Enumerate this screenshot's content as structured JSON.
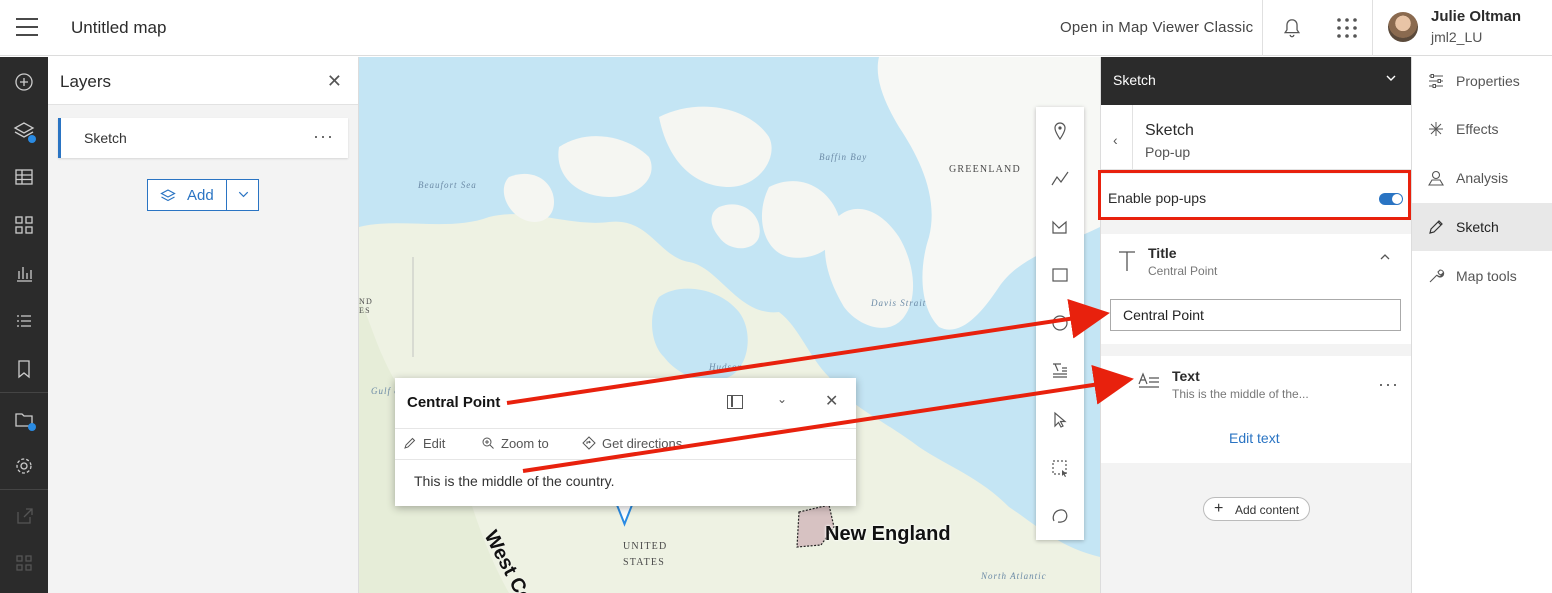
{
  "header": {
    "map_title": "Untitled map",
    "open_classic_label": "Open in Map Viewer Classic",
    "user_name": "Julie Oltman",
    "user_id": "jml2_LU"
  },
  "layers_panel": {
    "title": "Layers",
    "layer_items": [
      {
        "label": "Sketch"
      }
    ],
    "add_label": "Add"
  },
  "map": {
    "labels": {
      "beaufort_sea": "Beaufort Sea",
      "baffin_bay": "Baffin Bay",
      "greenland": "GREENLAND",
      "davis_strait": "Davis Strait",
      "gulf_alaska": "Gulf of Alaska",
      "hudson": "Hudson",
      "united_states": "UNITED STATES",
      "north_atlantic": "North Atlantic",
      "new_england": "New England",
      "west_coast": "West Coa",
      "partial_left": "ND ES"
    }
  },
  "popup": {
    "title": "Central Point",
    "actions": {
      "edit": "Edit",
      "zoom_to": "Zoom to",
      "directions": "Get directions"
    },
    "body": "This is the middle of the country."
  },
  "sketch_panel": {
    "dropdown_label": "Sketch",
    "sub_title": "Sketch",
    "sub_subtitle": "Pop-up",
    "enable_label": "Enable pop-ups",
    "enable_value": true,
    "title_label": "Title",
    "title_sub": "Central Point",
    "title_input_value": "Central Point",
    "text_label": "Text",
    "text_sub": "This is the middle of the...",
    "edit_text_label": "Edit text",
    "add_content_label": "Add content"
  },
  "right_rail": {
    "items": [
      {
        "label": "Properties",
        "icon": "sliders-icon"
      },
      {
        "label": "Effects",
        "icon": "sparkle-icon"
      },
      {
        "label": "Analysis",
        "icon": "analysis-icon"
      },
      {
        "label": "Sketch",
        "icon": "pen-icon",
        "active": true
      },
      {
        "label": "Map tools",
        "icon": "wrench-icon"
      }
    ]
  },
  "colors": {
    "accent": "#2a74c3",
    "annotation_red": "#e8210d",
    "dark_chrome": "#2b2b2b"
  }
}
